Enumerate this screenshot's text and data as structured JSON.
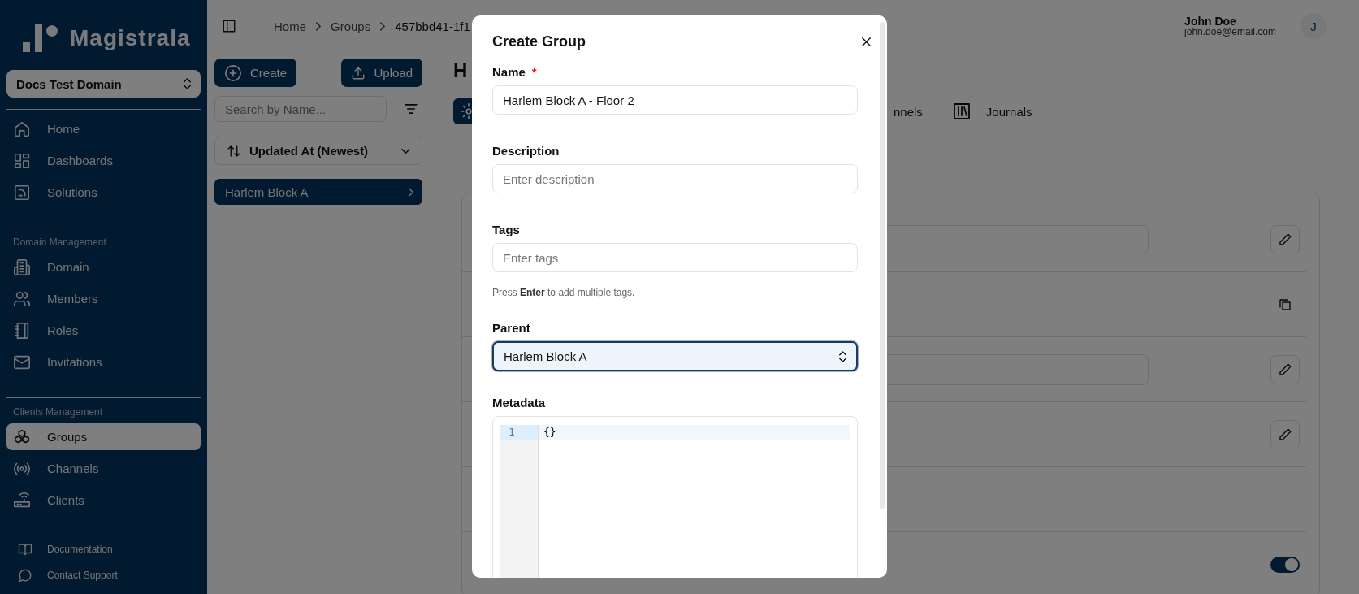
{
  "sidebar": {
    "logo_text": "Magistrala",
    "domain_select": "Docs Test Domain",
    "sections": [
      {
        "items": [
          {
            "label": "Home",
            "selected": false
          },
          {
            "label": "Dashboards",
            "selected": false
          },
          {
            "label": "Solutions",
            "selected": false
          }
        ]
      },
      {
        "heading": "Domain Management",
        "items": [
          {
            "label": "Domain",
            "selected": false
          },
          {
            "label": "Members",
            "selected": false
          },
          {
            "label": "Roles",
            "selected": false
          },
          {
            "label": "Invitations",
            "selected": false
          }
        ]
      },
      {
        "heading": "Clients Management",
        "items": [
          {
            "label": "Groups",
            "selected": true
          },
          {
            "label": "Channels",
            "selected": false
          },
          {
            "label": "Clients",
            "selected": false
          }
        ]
      }
    ],
    "footer_links": [
      {
        "label": "Documentation"
      },
      {
        "label": "Contact Support"
      }
    ]
  },
  "header": {
    "breadcrumbs": [
      "Home",
      "Groups",
      "457bbd41-1f1"
    ],
    "user": {
      "name": "John Doe",
      "email": "john.doe@email.com",
      "initial": "J"
    }
  },
  "group_list": {
    "create_button": "Create",
    "upload_button": "Upload",
    "search": {
      "placeholder": "Search by Name..."
    },
    "sort": {
      "value": "Updated At (Newest)"
    },
    "items": [
      {
        "label": "Harlem Block A",
        "selected": true
      }
    ]
  },
  "detail": {
    "title": "H",
    "tabs": [
      {
        "selected": true
      },
      {
        "label": "nnels",
        "selected": false
      },
      {
        "label": "Journals",
        "selected": false
      }
    ],
    "rows": [
      {
        "kind": "field"
      },
      {
        "kind": "copy"
      },
      {
        "kind": "textarea"
      },
      {
        "kind": "edit"
      },
      {
        "kind": "blank"
      },
      {
        "kind": "toggle",
        "on": true
      }
    ]
  },
  "modal": {
    "title": "Create Group",
    "fields": [
      {
        "kind": "text",
        "label": "Name",
        "required_mark": "*",
        "value": "Harlem Block A - Floor 2"
      },
      {
        "kind": "text",
        "label": "Description",
        "placeholder": "Enter description"
      },
      {
        "kind": "text",
        "label": "Tags",
        "placeholder": "Enter tags",
        "hint": "Press **Enter** to add multiple tags."
      },
      {
        "kind": "select",
        "label": "Parent",
        "value": "Harlem Block A",
        "focused": true
      },
      {
        "kind": "code",
        "label": "Metadata",
        "lines": [
          {
            "number": "1",
            "text": "{}",
            "active": true
          }
        ]
      }
    ]
  }
}
